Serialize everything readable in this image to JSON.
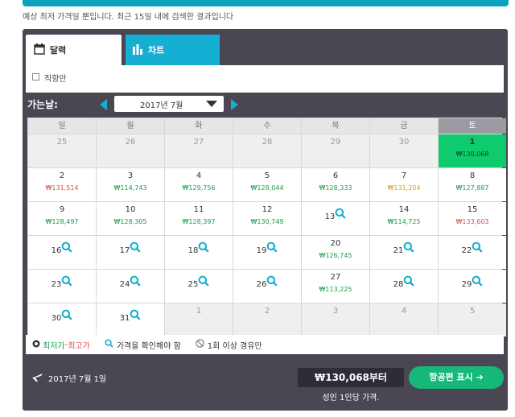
{
  "notice": "예상 최저 가격일 뿐입니다. 최근 15일 내에 검색한 결과입니다",
  "tabs": {
    "calendar": "달력",
    "chart": "차트"
  },
  "filter": {
    "direct_label": "직항만"
  },
  "departure_label": "가는날:",
  "month_select": "2017년 7월",
  "weekdays": [
    "일",
    "월",
    "화",
    "수",
    "목",
    "금",
    "토"
  ],
  "weeks": [
    [
      {
        "day": "25",
        "outside": true
      },
      {
        "day": "26",
        "outside": true
      },
      {
        "day": "27",
        "outside": true
      },
      {
        "day": "28",
        "outside": true
      },
      {
        "day": "29",
        "outside": true
      },
      {
        "day": "30",
        "outside": true
      },
      {
        "day": "1",
        "price": "₩130,068",
        "level": "dark",
        "selected": true
      }
    ],
    [
      {
        "day": "2",
        "price": "₩131,514",
        "level": "red"
      },
      {
        "day": "3",
        "price": "₩114,743",
        "level": "green"
      },
      {
        "day": "4",
        "price": "₩129,756",
        "level": "green"
      },
      {
        "day": "5",
        "price": "₩128,044",
        "level": "green"
      },
      {
        "day": "6",
        "price": "₩128,333",
        "level": "green"
      },
      {
        "day": "7",
        "price": "₩131,204",
        "level": "orange"
      },
      {
        "day": "8",
        "price": "₩127,887",
        "level": "green"
      }
    ],
    [
      {
        "day": "9",
        "price": "₩128,497",
        "level": "green"
      },
      {
        "day": "10",
        "price": "₩128,305",
        "level": "green"
      },
      {
        "day": "11",
        "price": "₩128,397",
        "level": "green"
      },
      {
        "day": "12",
        "price": "₩130,749",
        "level": "green"
      },
      {
        "day": "13",
        "search": true
      },
      {
        "day": "14",
        "price": "₩114,725",
        "level": "green"
      },
      {
        "day": "15",
        "price": "₩133,603",
        "level": "red"
      }
    ],
    [
      {
        "day": "16",
        "search": true
      },
      {
        "day": "17",
        "search": true
      },
      {
        "day": "18",
        "search": true
      },
      {
        "day": "19",
        "search": true
      },
      {
        "day": "20",
        "price": "₩126,745",
        "level": "green"
      },
      {
        "day": "21",
        "search": true
      },
      {
        "day": "22",
        "search": true
      }
    ],
    [
      {
        "day": "23",
        "search": true
      },
      {
        "day": "24",
        "search": true
      },
      {
        "day": "25",
        "search": true
      },
      {
        "day": "26",
        "search": true
      },
      {
        "day": "27",
        "price": "₩113,225",
        "level": "green"
      },
      {
        "day": "28",
        "search": true
      },
      {
        "day": "29",
        "search": true
      }
    ],
    [
      {
        "day": "30",
        "search": true
      },
      {
        "day": "31",
        "search": true
      },
      {
        "day": "1",
        "outside": true
      },
      {
        "day": "2",
        "outside": true
      },
      {
        "day": "3",
        "outside": true
      },
      {
        "day": "4",
        "outside": true
      },
      {
        "day": "5",
        "outside": true
      }
    ]
  ],
  "legend": {
    "lowest": "최저가",
    "separator": " - ",
    "highest": "최고가",
    "check_price": "가격을 확인해야 함",
    "one_stop": "1회 이상 경유만"
  },
  "footer": {
    "selected_date": "2017년 7월 1일",
    "price_from": "₩130,068부터",
    "per_person": "성인 1인당 가격.",
    "show_flights": "항공편 표시 ➔"
  },
  "colors": {
    "accent_blue": "#16afd4",
    "selected_green": "#0ecc6e",
    "price_green": "#19a04d",
    "price_red": "#e34b4b",
    "price_orange": "#e0a000",
    "panel_bg": "#4a4652"
  },
  "icons": [
    "calendar-icon",
    "chart-icon",
    "search-icon",
    "plane-icon",
    "prohibited-icon",
    "price-dot-icon"
  ]
}
